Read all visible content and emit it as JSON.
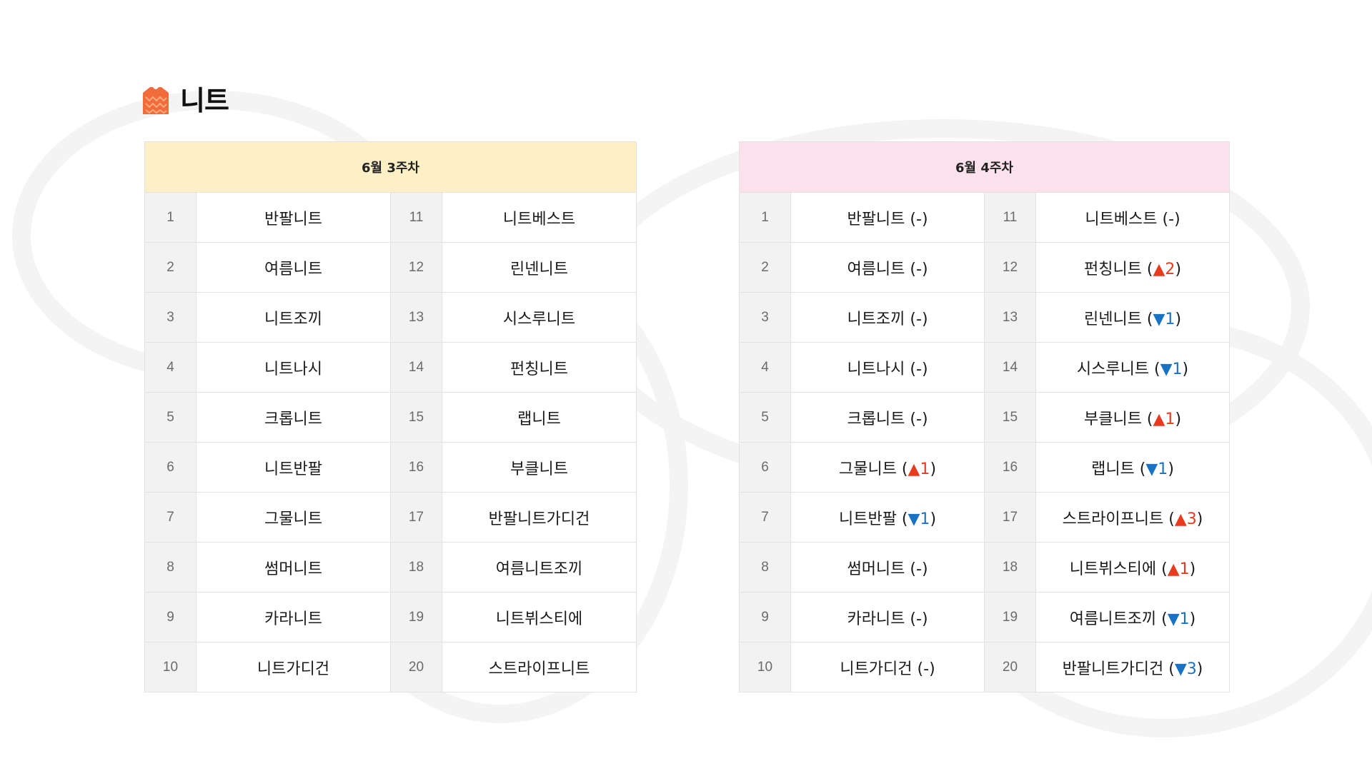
{
  "header": {
    "title": "니트",
    "icon": "sweater-icon"
  },
  "colors": {
    "week3_header_bg": "#fdf0c6",
    "week4_header_bg": "#fde2ee",
    "up": "#e83a1f",
    "down": "#1a72c2",
    "icon": "#f26b3a"
  },
  "week3": {
    "title": "6월 3주차",
    "rows": [
      {
        "rank": "1",
        "name": "반팔니트",
        "rank2": "11",
        "name2": "니트베스트"
      },
      {
        "rank": "2",
        "name": "여름니트",
        "rank2": "12",
        "name2": "린넨니트"
      },
      {
        "rank": "3",
        "name": "니트조끼",
        "rank2": "13",
        "name2": "시스루니트"
      },
      {
        "rank": "4",
        "name": "니트나시",
        "rank2": "14",
        "name2": "펀칭니트"
      },
      {
        "rank": "5",
        "name": "크롭니트",
        "rank2": "15",
        "name2": "랩니트"
      },
      {
        "rank": "6",
        "name": "니트반팔",
        "rank2": "16",
        "name2": "부클니트"
      },
      {
        "rank": "7",
        "name": "그물니트",
        "rank2": "17",
        "name2": "반팔니트가디건"
      },
      {
        "rank": "8",
        "name": "썸머니트",
        "rank2": "18",
        "name2": "여름니트조끼"
      },
      {
        "rank": "9",
        "name": "카라니트",
        "rank2": "19",
        "name2": "니트뷔스티에"
      },
      {
        "rank": "10",
        "name": "니트가디건",
        "rank2": "20",
        "name2": "스트라이프니트"
      }
    ]
  },
  "week4": {
    "title": "6월 4주차",
    "rows": [
      {
        "rank": "1",
        "name": "반팔니트",
        "change": "-",
        "rank2": "11",
        "name2": "니트베스트",
        "change2": "-"
      },
      {
        "rank": "2",
        "name": "여름니트",
        "change": "-",
        "rank2": "12",
        "name2": "펀칭니트",
        "change2": "▲2"
      },
      {
        "rank": "3",
        "name": "니트조끼",
        "change": "-",
        "rank2": "13",
        "name2": "린넨니트",
        "change2": "▼1"
      },
      {
        "rank": "4",
        "name": "니트나시",
        "change": "-",
        "rank2": "14",
        "name2": "시스루니트",
        "change2": "▼1"
      },
      {
        "rank": "5",
        "name": "크롭니트",
        "change": "-",
        "rank2": "15",
        "name2": "부클니트",
        "change2": "▲1"
      },
      {
        "rank": "6",
        "name": "그물니트",
        "change": "▲1",
        "rank2": "16",
        "name2": "랩니트",
        "change2": "▼1"
      },
      {
        "rank": "7",
        "name": "니트반팔",
        "change": "▼1",
        "rank2": "17",
        "name2": "스트라이프니트",
        "change2": "▲3"
      },
      {
        "rank": "8",
        "name": "썸머니트",
        "change": "-",
        "rank2": "18",
        "name2": "니트뷔스티에",
        "change2": "▲1"
      },
      {
        "rank": "9",
        "name": "카라니트",
        "change": "-",
        "rank2": "19",
        "name2": "여름니트조끼",
        "change2": "▼1"
      },
      {
        "rank": "10",
        "name": "니트가디건",
        "change": "-",
        "rank2": "20",
        "name2": "반팔니트가디건",
        "change2": "▼3"
      }
    ]
  }
}
